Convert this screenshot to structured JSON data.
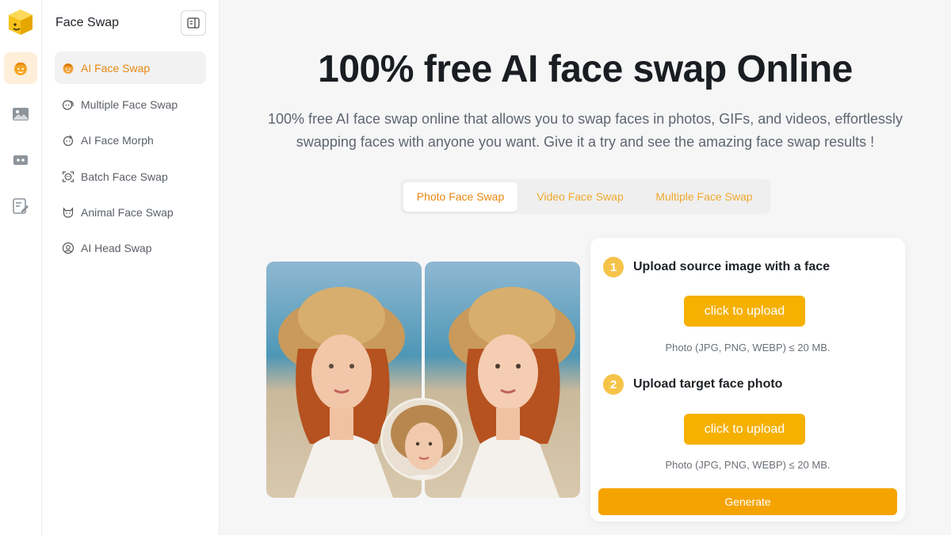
{
  "sidebar": {
    "title": "Face Swap",
    "items": [
      {
        "label": "AI Face Swap",
        "icon": "face-smile-icon",
        "active": true
      },
      {
        "label": "Multiple Face Swap",
        "icon": "faces-icon"
      },
      {
        "label": "AI Face Morph",
        "icon": "morph-icon"
      },
      {
        "label": "Batch Face Swap",
        "icon": "face-scan-icon"
      },
      {
        "label": "Animal Face Swap",
        "icon": "cat-face-icon"
      },
      {
        "label": "AI Head Swap",
        "icon": "head-swap-icon"
      }
    ]
  },
  "rail": {
    "items": [
      "face-swap-icon",
      "image-icon",
      "video-icon",
      "edit-icon"
    ]
  },
  "main": {
    "headline": "100% free AI face swap Online",
    "subtitle_line1": "100% free AI face swap online that allows you to swap faces in photos, GIFs, and videos, effortlessly",
    "subtitle_line2": "swapping faces with anyone you want. Give it a try and see the amazing face swap results !",
    "tabs": [
      {
        "label": "Photo Face Swap",
        "active": true
      },
      {
        "label": "Video Face Swap"
      },
      {
        "label": "Multiple Face Swap"
      }
    ]
  },
  "card": {
    "step1": {
      "number": "1",
      "label": "Upload source image with a face",
      "button": "click to upload",
      "hint": "Photo (JPG, PNG, WEBP) ≤ 20 MB."
    },
    "step2": {
      "number": "2",
      "label": "Upload target face photo",
      "button": "click to upload",
      "hint": "Photo (JPG, PNG, WEBP) ≤ 20 MB."
    },
    "generate": "Generate"
  },
  "colors": {
    "accent": "#e8870f",
    "button": "#f5b000",
    "step_badge": "#f6c34a"
  }
}
